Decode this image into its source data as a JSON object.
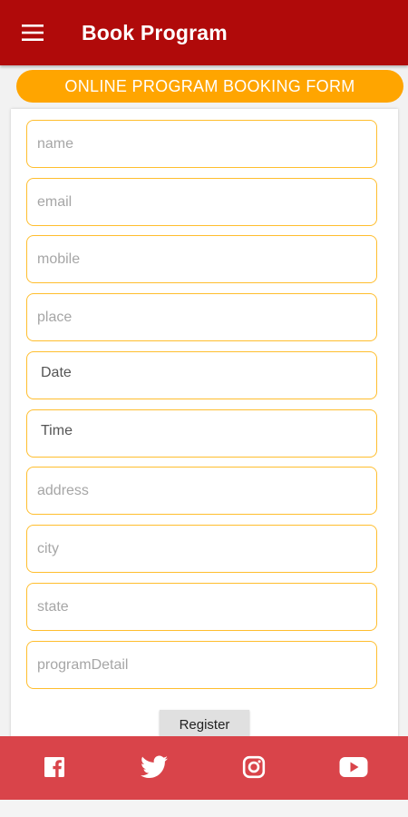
{
  "app_bar": {
    "title": "Book Program",
    "menu_icon": "hamburger-menu-icon",
    "background": "#b00a0a"
  },
  "banner": {
    "text": "ONLINE PROGRAM BOOKING FORM",
    "background": "#ffa500"
  },
  "form": {
    "fields": [
      {
        "placeholder": "name",
        "value": ""
      },
      {
        "placeholder": "email",
        "value": ""
      },
      {
        "placeholder": "mobile",
        "value": ""
      },
      {
        "placeholder": "place",
        "value": ""
      },
      {
        "placeholder": "Date",
        "value": ""
      },
      {
        "placeholder": "Time",
        "value": ""
      },
      {
        "placeholder": "address",
        "value": ""
      },
      {
        "placeholder": "city",
        "value": ""
      },
      {
        "placeholder": "state",
        "value": ""
      },
      {
        "placeholder": "programDetail",
        "value": ""
      }
    ],
    "border_color": "#ffbe2e",
    "register_label": "Register"
  },
  "footer": {
    "background": "#d9444a",
    "icons": [
      "facebook-icon",
      "twitter-icon",
      "instagram-icon",
      "youtube-icon"
    ]
  }
}
